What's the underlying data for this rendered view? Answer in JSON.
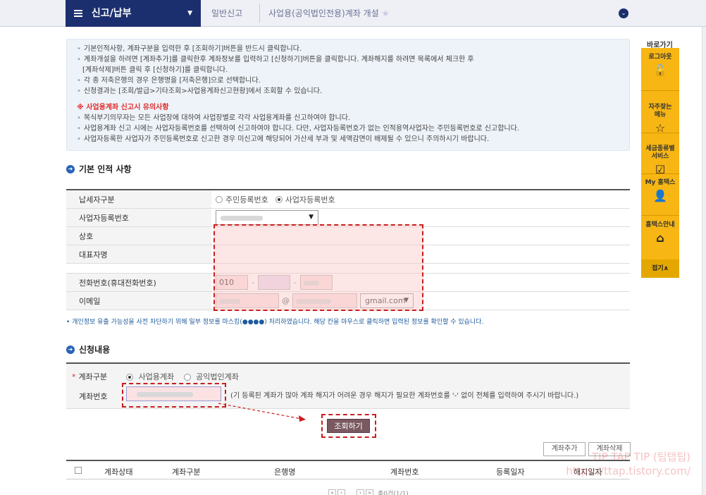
{
  "topbar": {
    "menu_title": "신고/납부",
    "crumb1": "일반신고",
    "crumb2": "사업용(공익법인전용)계좌 개설"
  },
  "info": {
    "lines": [
      "기본인적사항, 계좌구분을 입력한 후 [조회하기]버튼을 반드시 클릭합니다.",
      "계좌개설을 하려면 [계좌추가]를 클릭한후 계좌정보를 입력하고 [신청하기]버튼을 클릭합니다. 계좌해지를 하려면 목록에서 체크한 후",
      "[계좌삭제]버튼 클릭 후 [신청하기]를 클릭합니다.",
      "각 종 저축은행의 경우 은행명을 [저축은행]으로 선택합니다.",
      "신청결과는 [조회/발급>기타조회>사업용계좌신고현황]에서 조회할 수 있습니다."
    ],
    "caution_title": "※ 사업용계좌 신고시 유의사항",
    "caution_lines": [
      "복식부기의무자는 모든 사업장에 대하여 사업장별로 각각 사업용계좌를 신고하여야 합니다.",
      "사업용계좌 신고 시에는 사업자등록번호를 선택하여 신고하여야 합니다. 다만, 사업자등록번호가 없는 인적용역사업자는 주민등록번호로 신고합니다.",
      "사업자등록한 사업자가 주민등록번호로 신고한 경우 미신고에 해당되어 가산세 부과 및 세액감면이 배제될 수 있으니 주의하시기 바랍니다."
    ]
  },
  "section1": {
    "title": "기본 인적 사항",
    "rows": {
      "taxpayer_type": "납세자구분",
      "bizno": "사업자등록번호",
      "company": "상호",
      "ceo": "대표자명",
      "phone": "전화번호(휴대전화번호)",
      "email": "이메일"
    },
    "radio_resident": "주민등록번호",
    "radio_business": "사업자등록번호",
    "phone_prefix": "010",
    "email_at": "@",
    "email_domain": "gmail.com",
    "notice": "• 개인정보 유출 가능성을 사전 차단하기 위해 일부 정보를 마스킹(●●●●) 처리하였습니다. 해당 칸을 마우스로 클릭하면 입력된 정보를 확인할 수 있습니다."
  },
  "section2": {
    "title": "신청내용",
    "account_type_label": "계좌구분",
    "account_type_opt1": "사업용계좌",
    "account_type_opt2": "공익법인계좌",
    "account_no_label": "계좌번호",
    "account_no_note": "(기 등록된 계좌가 많아 계좌 해지가 어려운 경우 해지가 필요한 계좌번호를 '-' 없이 전체를 입력하여 주시기 바랍니다.)",
    "query_button": "조회하기"
  },
  "list": {
    "add_button": "계좌추가",
    "delete_button": "계좌삭제",
    "columns": [
      "계좌상태",
      "계좌구분",
      "은행명",
      "계좌번호",
      "등록일자",
      "해지일자"
    ],
    "pager_text": "총0건(1/1)"
  },
  "sidebar": {
    "title": "바로가기",
    "items": [
      "로그아웃",
      "자주찾는\n메뉴",
      "세금종류별\n서비스",
      "My 홈택스",
      "홈택스안내"
    ],
    "close": "접기∧"
  },
  "watermark": {
    "line1": "TIP TAP TIP (팁탭팁)",
    "line2": "https://ttap.tistory.com/"
  }
}
